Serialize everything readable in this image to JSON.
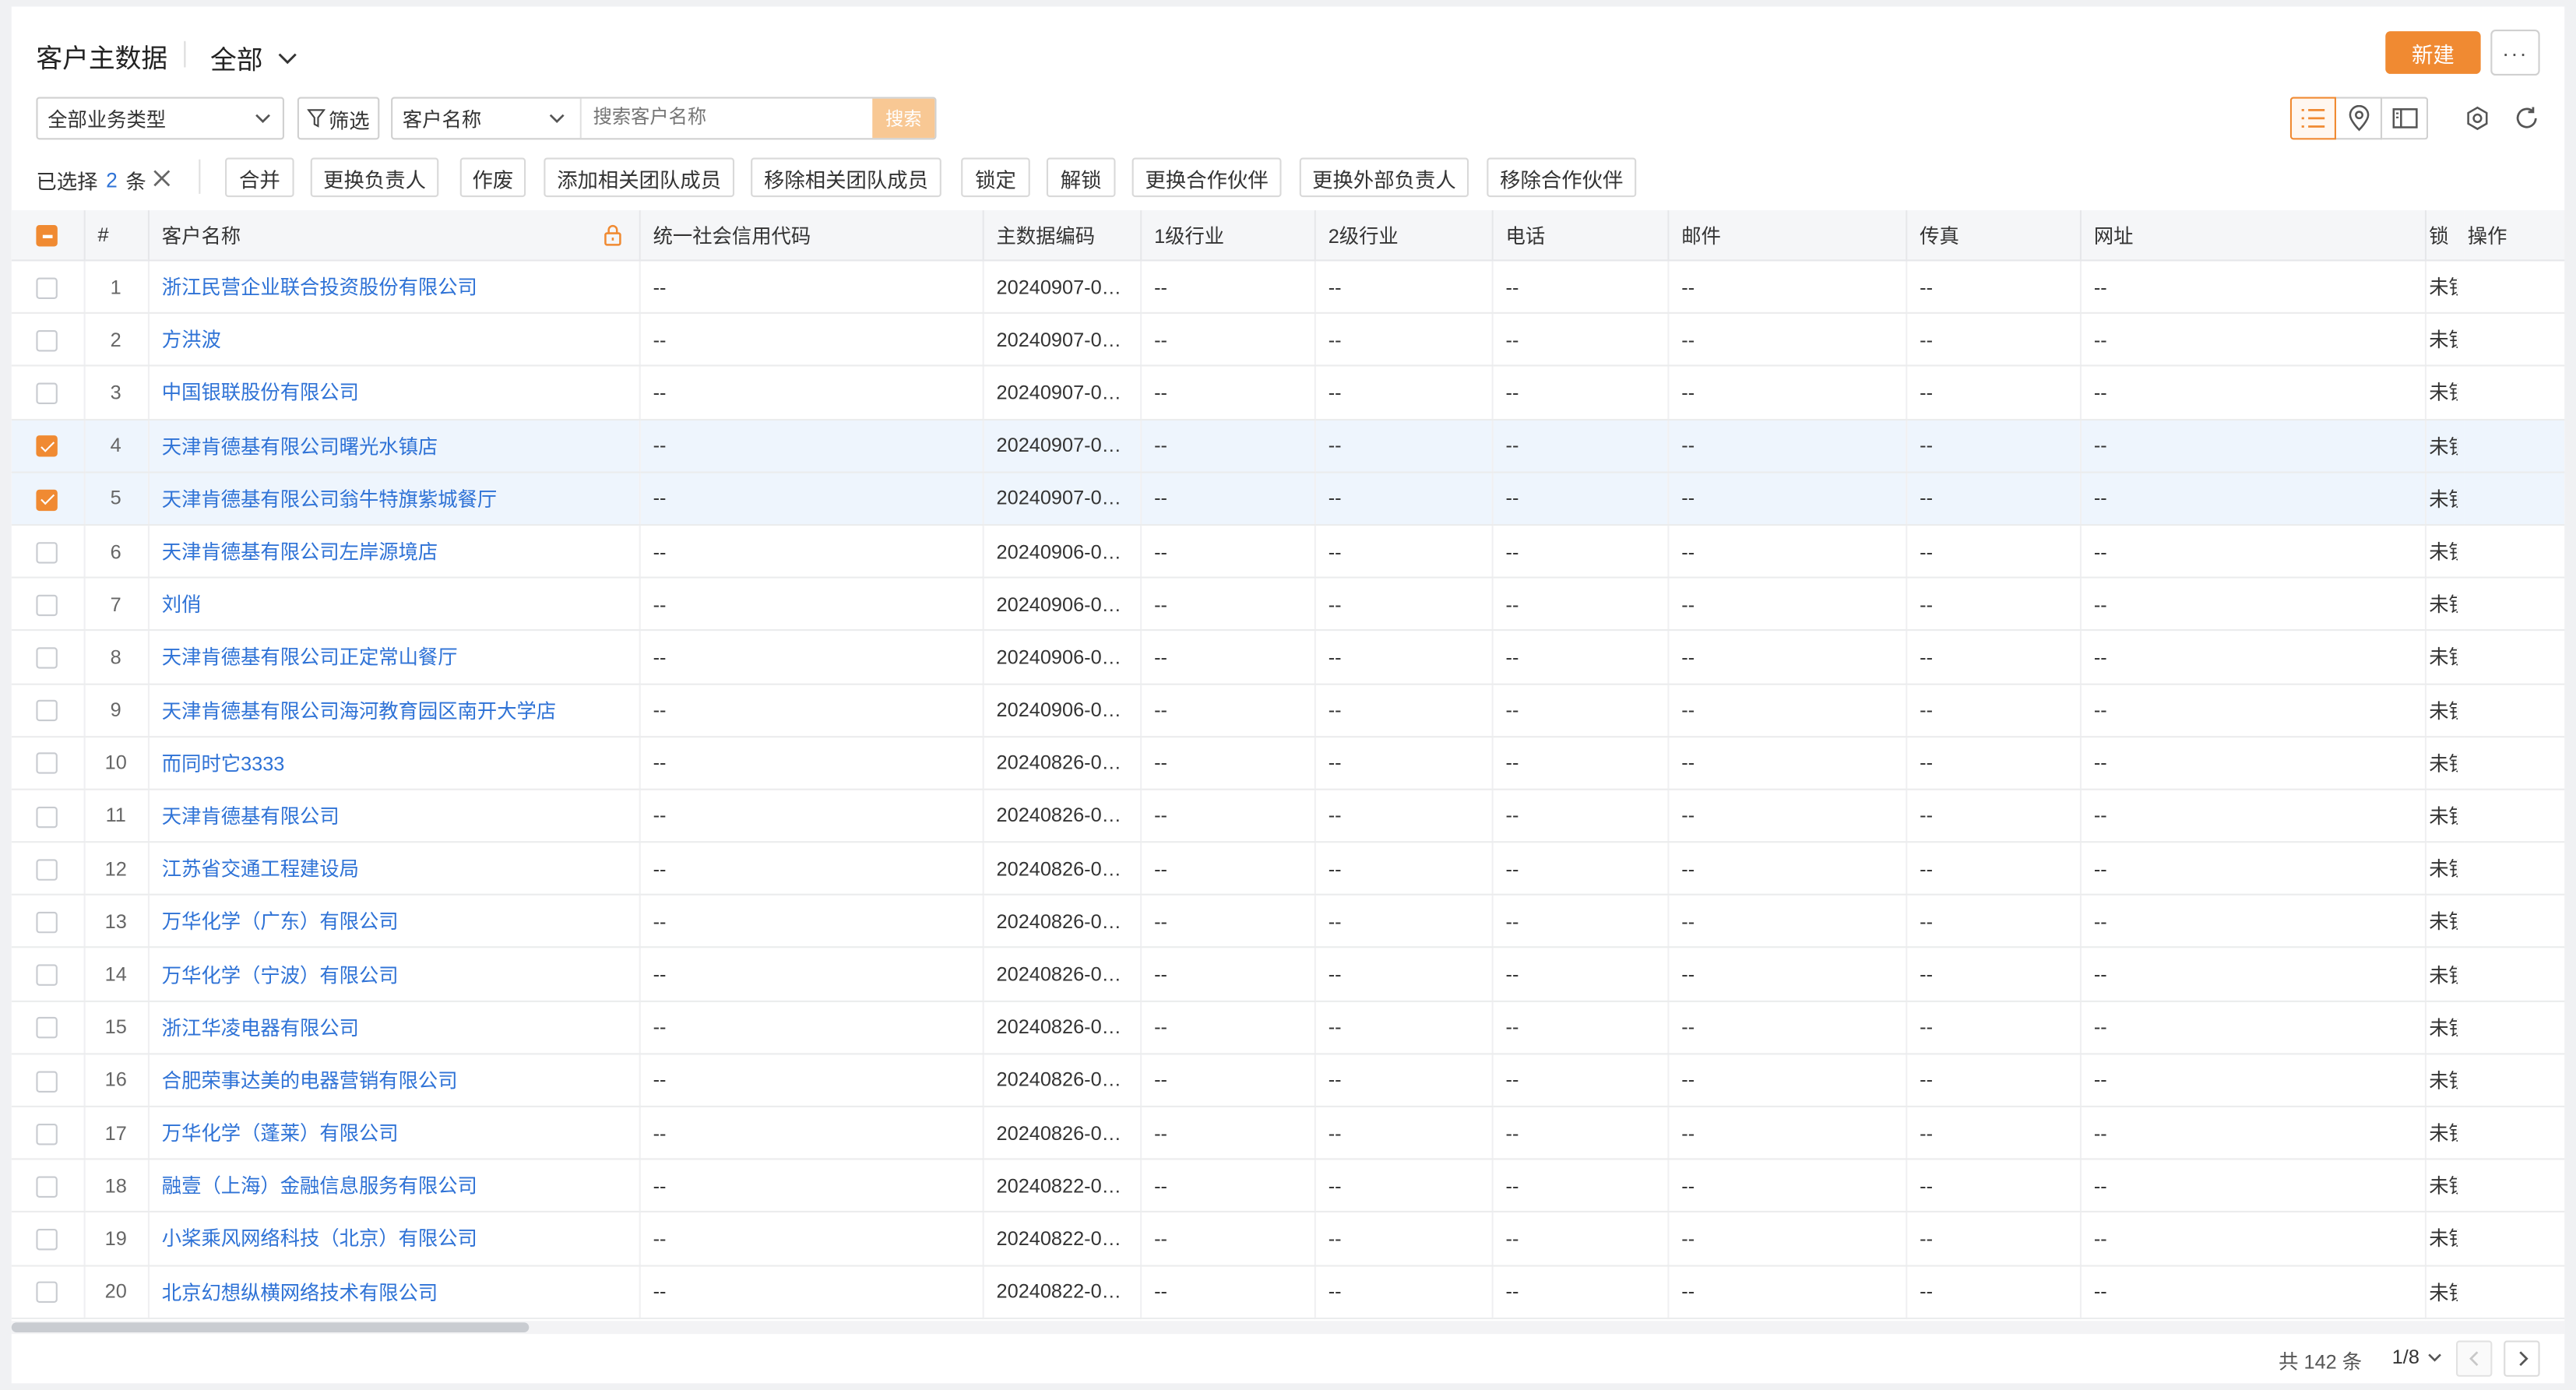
{
  "header": {
    "title": "客户主数据",
    "view_label": "全部",
    "new_label": "新建",
    "more_label": "···"
  },
  "toolbar": {
    "business_type": "全部业务类型",
    "filter_label": "筛选",
    "search_field": "客户名称",
    "search_placeholder": "搜索客户名称",
    "search_label": "搜索"
  },
  "selection": {
    "prefix": "已选择",
    "count": "2",
    "suffix": "条",
    "actions": [
      "合并",
      "更换负责人",
      "作废",
      "添加相关团队成员",
      "移除相关团队成员",
      "锁定",
      "解锁",
      "更换合作伙伴",
      "更换外部负责人",
      "移除合作伙伴"
    ]
  },
  "table": {
    "columns": [
      "#",
      "客户名称",
      "统一社会信用代码",
      "主数据编码",
      "1级行业",
      "2级行业",
      "电话",
      "邮件",
      "传真",
      "网址",
      "锁定",
      "操作"
    ],
    "lock_col_visible": "锁",
    "rows": [
      {
        "no": "1",
        "name": "浙江民营企业联合投资股份有限公司",
        "code": "--",
        "mdm": "20240907-0…",
        "ind1": "--",
        "ind2": "--",
        "phone": "--",
        "email": "--",
        "fax": "--",
        "web": "--",
        "lock": "未锁定",
        "selected": false
      },
      {
        "no": "2",
        "name": "方洪波",
        "code": "--",
        "mdm": "20240907-0…",
        "ind1": "--",
        "ind2": "--",
        "phone": "--",
        "email": "--",
        "fax": "--",
        "web": "--",
        "lock": "未锁定",
        "selected": false
      },
      {
        "no": "3",
        "name": "中国银联股份有限公司",
        "code": "--",
        "mdm": "20240907-0…",
        "ind1": "--",
        "ind2": "--",
        "phone": "--",
        "email": "--",
        "fax": "--",
        "web": "--",
        "lock": "未锁定",
        "selected": false
      },
      {
        "no": "4",
        "name": "天津肯德基有限公司曙光水镇店",
        "code": "--",
        "mdm": "20240907-0…",
        "ind1": "--",
        "ind2": "--",
        "phone": "--",
        "email": "--",
        "fax": "--",
        "web": "--",
        "lock": "未锁定",
        "selected": true
      },
      {
        "no": "5",
        "name": "天津肯德基有限公司翁牛特旗紫城餐厅",
        "code": "--",
        "mdm": "20240907-0…",
        "ind1": "--",
        "ind2": "--",
        "phone": "--",
        "email": "--",
        "fax": "--",
        "web": "--",
        "lock": "未锁定",
        "selected": true
      },
      {
        "no": "6",
        "name": "天津肯德基有限公司左岸源境店",
        "code": "--",
        "mdm": "20240906-0…",
        "ind1": "--",
        "ind2": "--",
        "phone": "--",
        "email": "--",
        "fax": "--",
        "web": "--",
        "lock": "未锁定",
        "selected": false
      },
      {
        "no": "7",
        "name": "刘俏",
        "code": "--",
        "mdm": "20240906-0…",
        "ind1": "--",
        "ind2": "--",
        "phone": "--",
        "email": "--",
        "fax": "--",
        "web": "--",
        "lock": "未锁定",
        "selected": false
      },
      {
        "no": "8",
        "name": "天津肯德基有限公司正定常山餐厅",
        "code": "--",
        "mdm": "20240906-0…",
        "ind1": "--",
        "ind2": "--",
        "phone": "--",
        "email": "--",
        "fax": "--",
        "web": "--",
        "lock": "未锁定",
        "selected": false
      },
      {
        "no": "9",
        "name": "天津肯德基有限公司海河教育园区南开大学店",
        "code": "--",
        "mdm": "20240906-0…",
        "ind1": "--",
        "ind2": "--",
        "phone": "--",
        "email": "--",
        "fax": "--",
        "web": "--",
        "lock": "未锁定",
        "selected": false
      },
      {
        "no": "10",
        "name": "而同时它3333",
        "code": "--",
        "mdm": "20240826-0…",
        "ind1": "--",
        "ind2": "--",
        "phone": "--",
        "email": "--",
        "fax": "--",
        "web": "--",
        "lock": "未锁定",
        "selected": false
      },
      {
        "no": "11",
        "name": "天津肯德基有限公司",
        "code": "--",
        "mdm": "20240826-0…",
        "ind1": "--",
        "ind2": "--",
        "phone": "--",
        "email": "--",
        "fax": "--",
        "web": "--",
        "lock": "未锁定",
        "selected": false
      },
      {
        "no": "12",
        "name": "江苏省交通工程建设局",
        "code": "--",
        "mdm": "20240826-0…",
        "ind1": "--",
        "ind2": "--",
        "phone": "--",
        "email": "--",
        "fax": "--",
        "web": "--",
        "lock": "未锁定",
        "selected": false
      },
      {
        "no": "13",
        "name": "万华化学（广东）有限公司",
        "code": "--",
        "mdm": "20240826-0…",
        "ind1": "--",
        "ind2": "--",
        "phone": "--",
        "email": "--",
        "fax": "--",
        "web": "--",
        "lock": "未锁定",
        "selected": false
      },
      {
        "no": "14",
        "name": "万华化学（宁波）有限公司",
        "code": "--",
        "mdm": "20240826-0…",
        "ind1": "--",
        "ind2": "--",
        "phone": "--",
        "email": "--",
        "fax": "--",
        "web": "--",
        "lock": "未锁定",
        "selected": false
      },
      {
        "no": "15",
        "name": "浙江华凌电器有限公司",
        "code": "--",
        "mdm": "20240826-0…",
        "ind1": "--",
        "ind2": "--",
        "phone": "--",
        "email": "--",
        "fax": "--",
        "web": "--",
        "lock": "未锁定",
        "selected": false
      },
      {
        "no": "16",
        "name": "合肥荣事达美的电器营销有限公司",
        "code": "--",
        "mdm": "20240826-0…",
        "ind1": "--",
        "ind2": "--",
        "phone": "--",
        "email": "--",
        "fax": "--",
        "web": "--",
        "lock": "未锁定",
        "selected": false
      },
      {
        "no": "17",
        "name": "万华化学（蓬莱）有限公司",
        "code": "--",
        "mdm": "20240826-0…",
        "ind1": "--",
        "ind2": "--",
        "phone": "--",
        "email": "--",
        "fax": "--",
        "web": "--",
        "lock": "未锁定",
        "selected": false
      },
      {
        "no": "18",
        "name": "融壹（上海）金融信息服务有限公司",
        "code": "--",
        "mdm": "20240822-0…",
        "ind1": "--",
        "ind2": "--",
        "phone": "--",
        "email": "--",
        "fax": "--",
        "web": "--",
        "lock": "未锁定",
        "selected": false
      },
      {
        "no": "19",
        "name": "小桨乘风网络科技（北京）有限公司",
        "code": "--",
        "mdm": "20240822-0…",
        "ind1": "--",
        "ind2": "--",
        "phone": "--",
        "email": "--",
        "fax": "--",
        "web": "--",
        "lock": "未锁定",
        "selected": false
      },
      {
        "no": "20",
        "name": "北京幻想纵横网络技术有限公司",
        "code": "--",
        "mdm": "20240822-0…",
        "ind1": "--",
        "ind2": "--",
        "phone": "--",
        "email": "--",
        "fax": "--",
        "web": "--",
        "lock": "未锁定",
        "selected": false
      }
    ]
  },
  "footer": {
    "total": "共 142 条",
    "page": "1/8"
  },
  "colors": {
    "accent": "#f08a32",
    "link": "#2e72d6",
    "selected_row": "#eef5fd",
    "search_button": "#f8c894"
  }
}
